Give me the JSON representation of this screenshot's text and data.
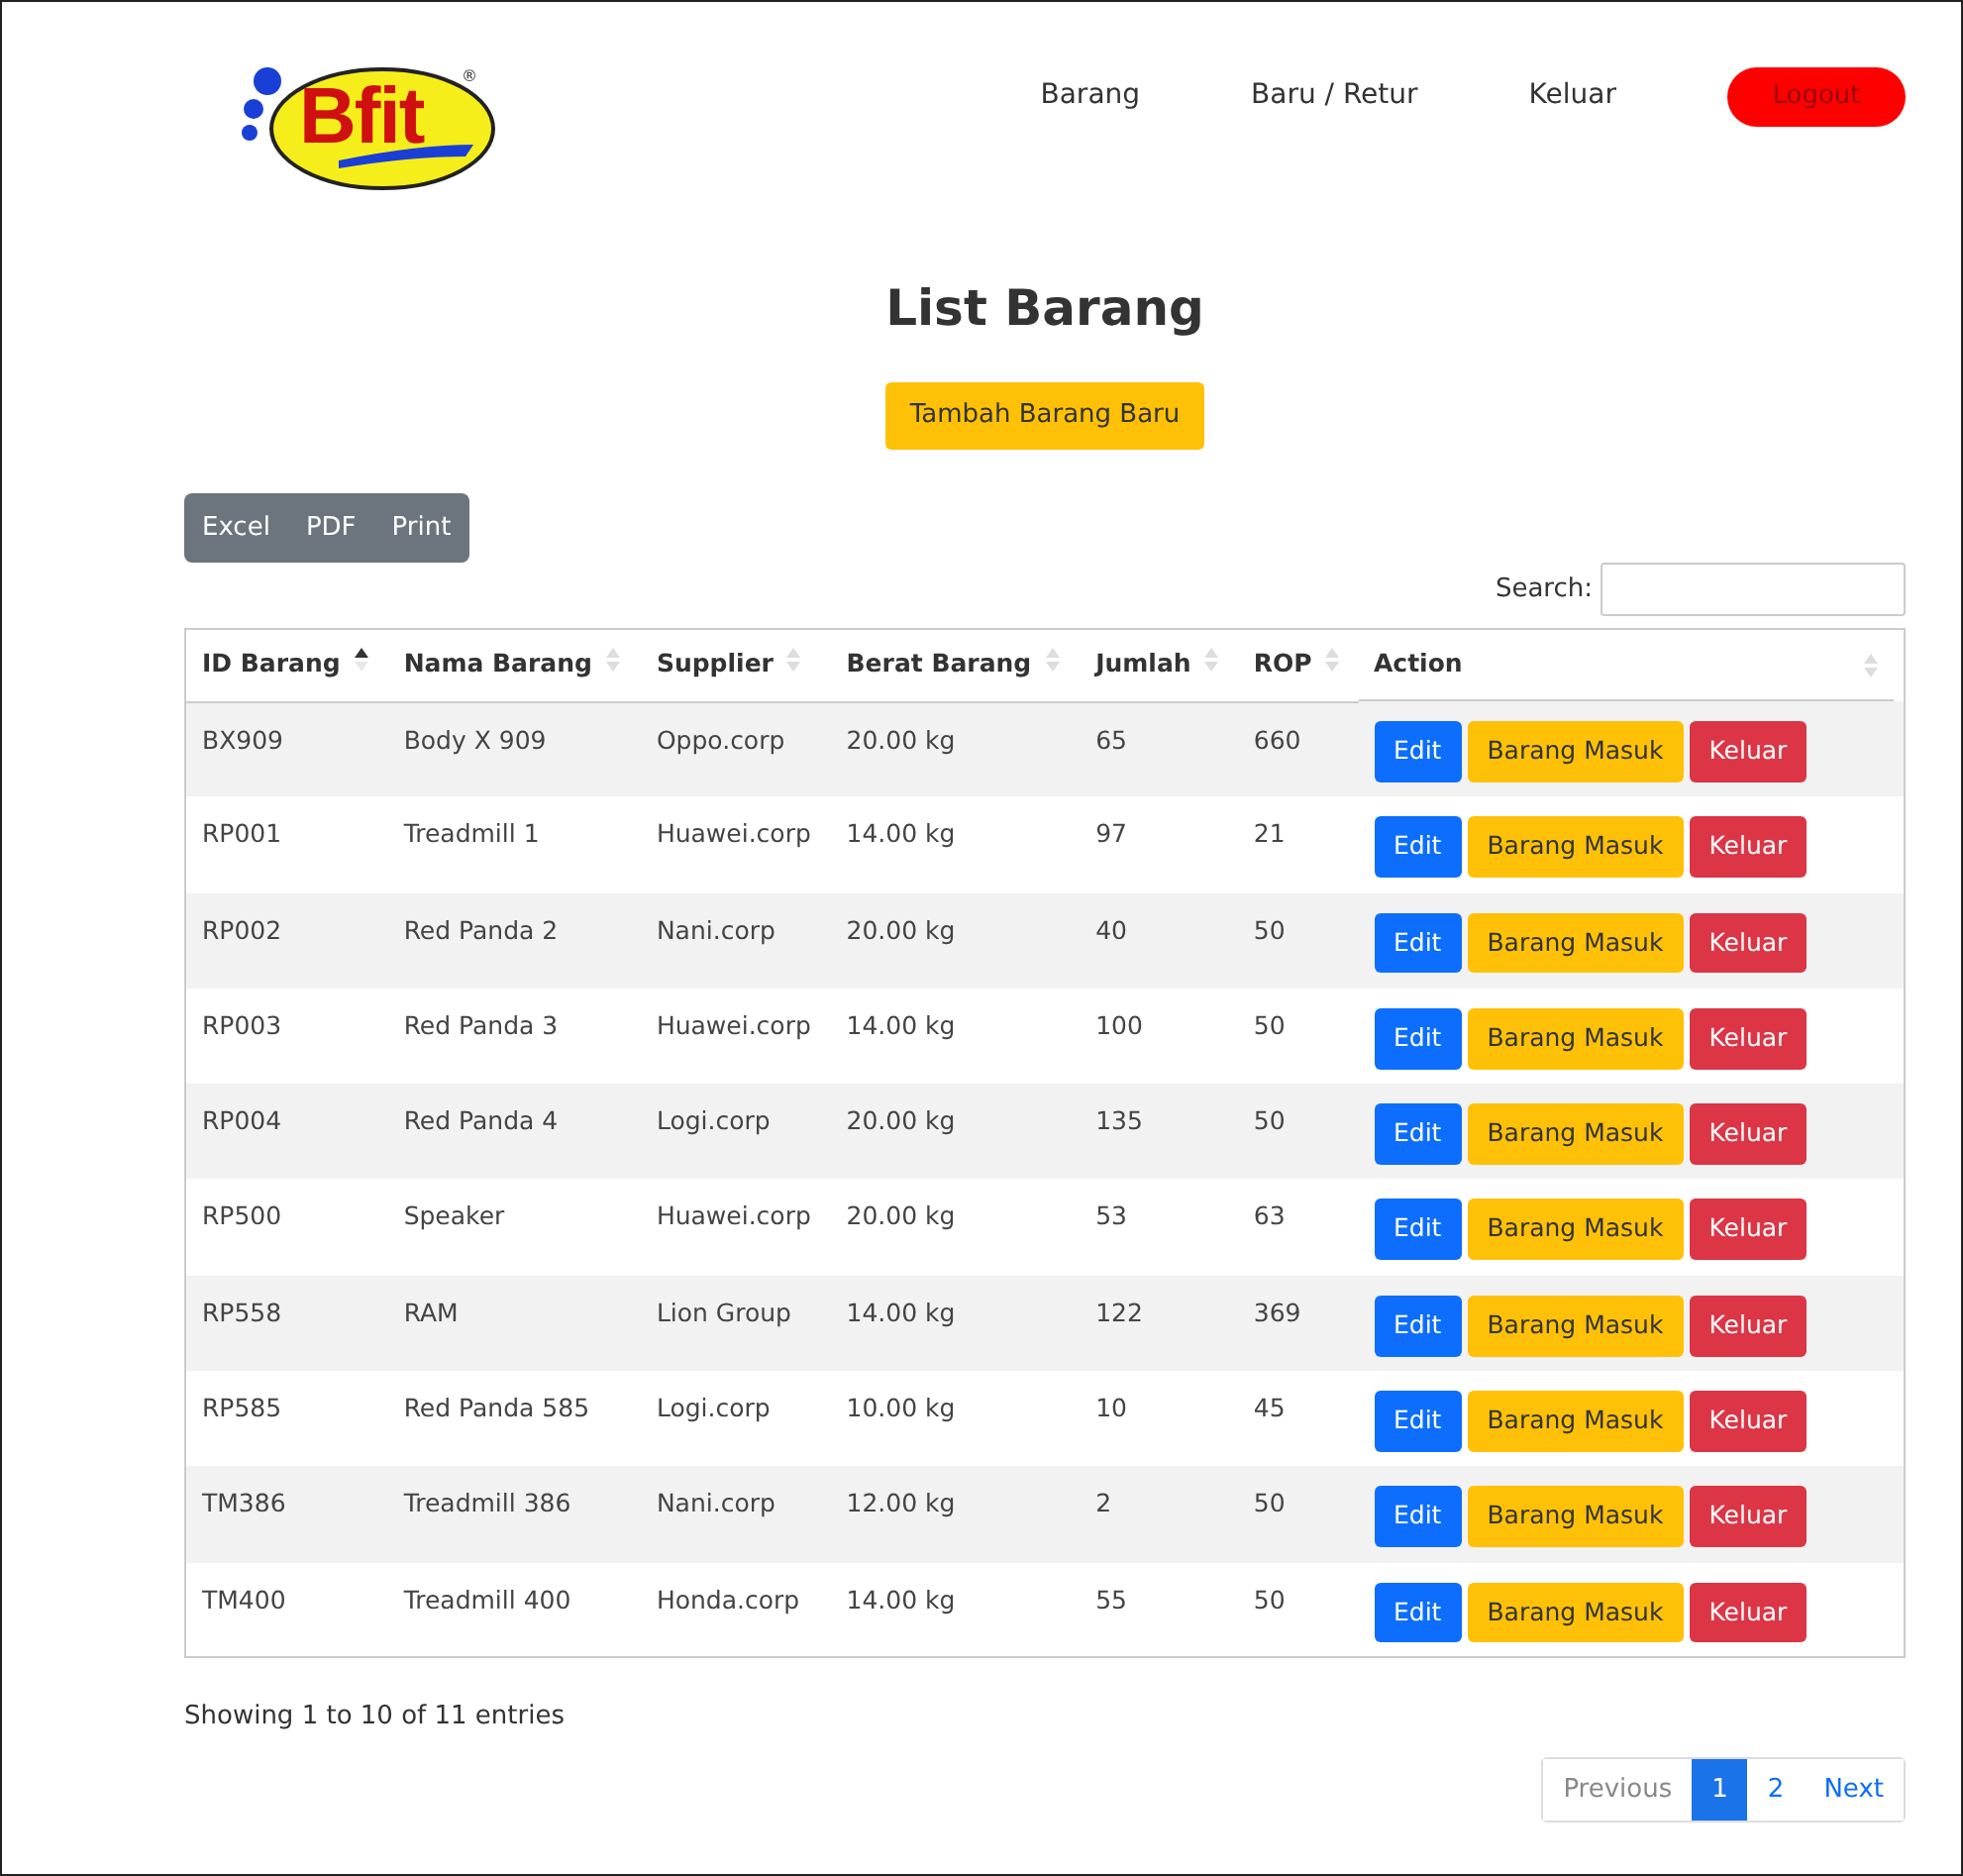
{
  "logo": {
    "text": "Bfit",
    "mark": "®"
  },
  "nav": [
    {
      "label": "Barang",
      "kind": "link"
    },
    {
      "label": "Baru / Retur",
      "kind": "link"
    },
    {
      "label": "Keluar",
      "kind": "link"
    },
    {
      "label": "Logout",
      "kind": "button"
    }
  ],
  "title": "List Barang",
  "add_button": "Tambah Barang Baru",
  "export_buttons": [
    "Excel",
    "PDF",
    "Print"
  ],
  "search": {
    "label": "Search:"
  },
  "table": {
    "columns": [
      {
        "label": "ID Barang",
        "sorted": true
      },
      {
        "label": "Nama Barang",
        "sorted": false
      },
      {
        "label": "Supplier",
        "sorted": false
      },
      {
        "label": "Berat Barang",
        "sorted": false
      },
      {
        "label": "Jumlah",
        "sorted": false
      },
      {
        "label": "ROP",
        "sorted": false
      },
      {
        "label": "Action",
        "sorted": false
      }
    ],
    "rows": [
      {
        "cells": [
          "BX909",
          "Body X 909",
          "Oppo.corp",
          "20.00 kg",
          "65",
          "660"
        ],
        "actions": [
          {
            "label": "Edit",
            "kind": "primary"
          },
          {
            "label": "Barang Masuk",
            "kind": "warning"
          },
          {
            "label": "Keluar",
            "kind": "danger"
          }
        ]
      },
      {
        "cells": [
          "RP001",
          "Treadmill 1",
          "Huawei.corp",
          "14.00 kg",
          "97",
          "21"
        ],
        "actions": [
          {
            "label": "Edit",
            "kind": "primary"
          },
          {
            "label": "Barang Masuk",
            "kind": "warning"
          },
          {
            "label": "Keluar",
            "kind": "danger"
          }
        ]
      },
      {
        "cells": [
          "RP002",
          "Red Panda 2",
          "Nani.corp",
          "20.00 kg",
          "40",
          "50"
        ],
        "actions": [
          {
            "label": "Edit",
            "kind": "primary"
          },
          {
            "label": "Barang Masuk",
            "kind": "warning"
          },
          {
            "label": "Keluar",
            "kind": "danger"
          }
        ]
      },
      {
        "cells": [
          "RP003",
          "Red Panda 3",
          "Huawei.corp",
          "14.00 kg",
          "100",
          "50"
        ],
        "actions": [
          {
            "label": "Edit",
            "kind": "primary"
          },
          {
            "label": "Barang Masuk",
            "kind": "warning"
          },
          {
            "label": "Keluar",
            "kind": "danger"
          }
        ]
      },
      {
        "cells": [
          "RP004",
          "Red Panda 4",
          "Logi.corp",
          "20.00 kg",
          "135",
          "50"
        ],
        "actions": [
          {
            "label": "Edit",
            "kind": "primary"
          },
          {
            "label": "Barang Masuk",
            "kind": "warning"
          },
          {
            "label": "Keluar",
            "kind": "danger"
          }
        ]
      },
      {
        "cells": [
          "RP500",
          "Speaker",
          "Huawei.corp",
          "20.00 kg",
          "53",
          "63"
        ],
        "actions": [
          {
            "label": "Edit",
            "kind": "primary"
          },
          {
            "label": "Barang Masuk",
            "kind": "warning"
          },
          {
            "label": "Keluar",
            "kind": "danger"
          }
        ]
      },
      {
        "cells": [
          "RP558",
          "RAM",
          "Lion Group",
          "14.00 kg",
          "122",
          "369"
        ],
        "actions": [
          {
            "label": "Edit",
            "kind": "primary"
          },
          {
            "label": "Barang Masuk",
            "kind": "warning"
          },
          {
            "label": "Keluar",
            "kind": "danger"
          }
        ]
      },
      {
        "cells": [
          "RP585",
          "Red Panda 585",
          "Logi.corp",
          "10.00 kg",
          "10",
          "45"
        ],
        "actions": [
          {
            "label": "Edit",
            "kind": "primary"
          },
          {
            "label": "Barang Masuk",
            "kind": "warning"
          },
          {
            "label": "Keluar",
            "kind": "danger"
          }
        ]
      },
      {
        "cells": [
          "TM386",
          "Treadmill 386",
          "Nani.corp",
          "12.00 kg",
          "2",
          "50"
        ],
        "actions": [
          {
            "label": "Edit",
            "kind": "primary"
          },
          {
            "label": "Barang Masuk",
            "kind": "warning"
          },
          {
            "label": "Keluar",
            "kind": "danger"
          }
        ]
      },
      {
        "cells": [
          "TM400",
          "Treadmill 400",
          "Honda.corp",
          "14.00 kg",
          "55",
          "50"
        ],
        "actions": [
          {
            "label": "Edit",
            "kind": "primary"
          },
          {
            "label": "Barang Masuk",
            "kind": "warning"
          },
          {
            "label": "Keluar",
            "kind": "danger"
          }
        ]
      }
    ]
  },
  "info": "Showing 1 to 10 of 11 entries",
  "pagination": {
    "previous": "Previous",
    "next": "Next",
    "pages": [
      {
        "label": "1",
        "selected": true
      },
      {
        "label": "2",
        "selected": false
      }
    ]
  }
}
